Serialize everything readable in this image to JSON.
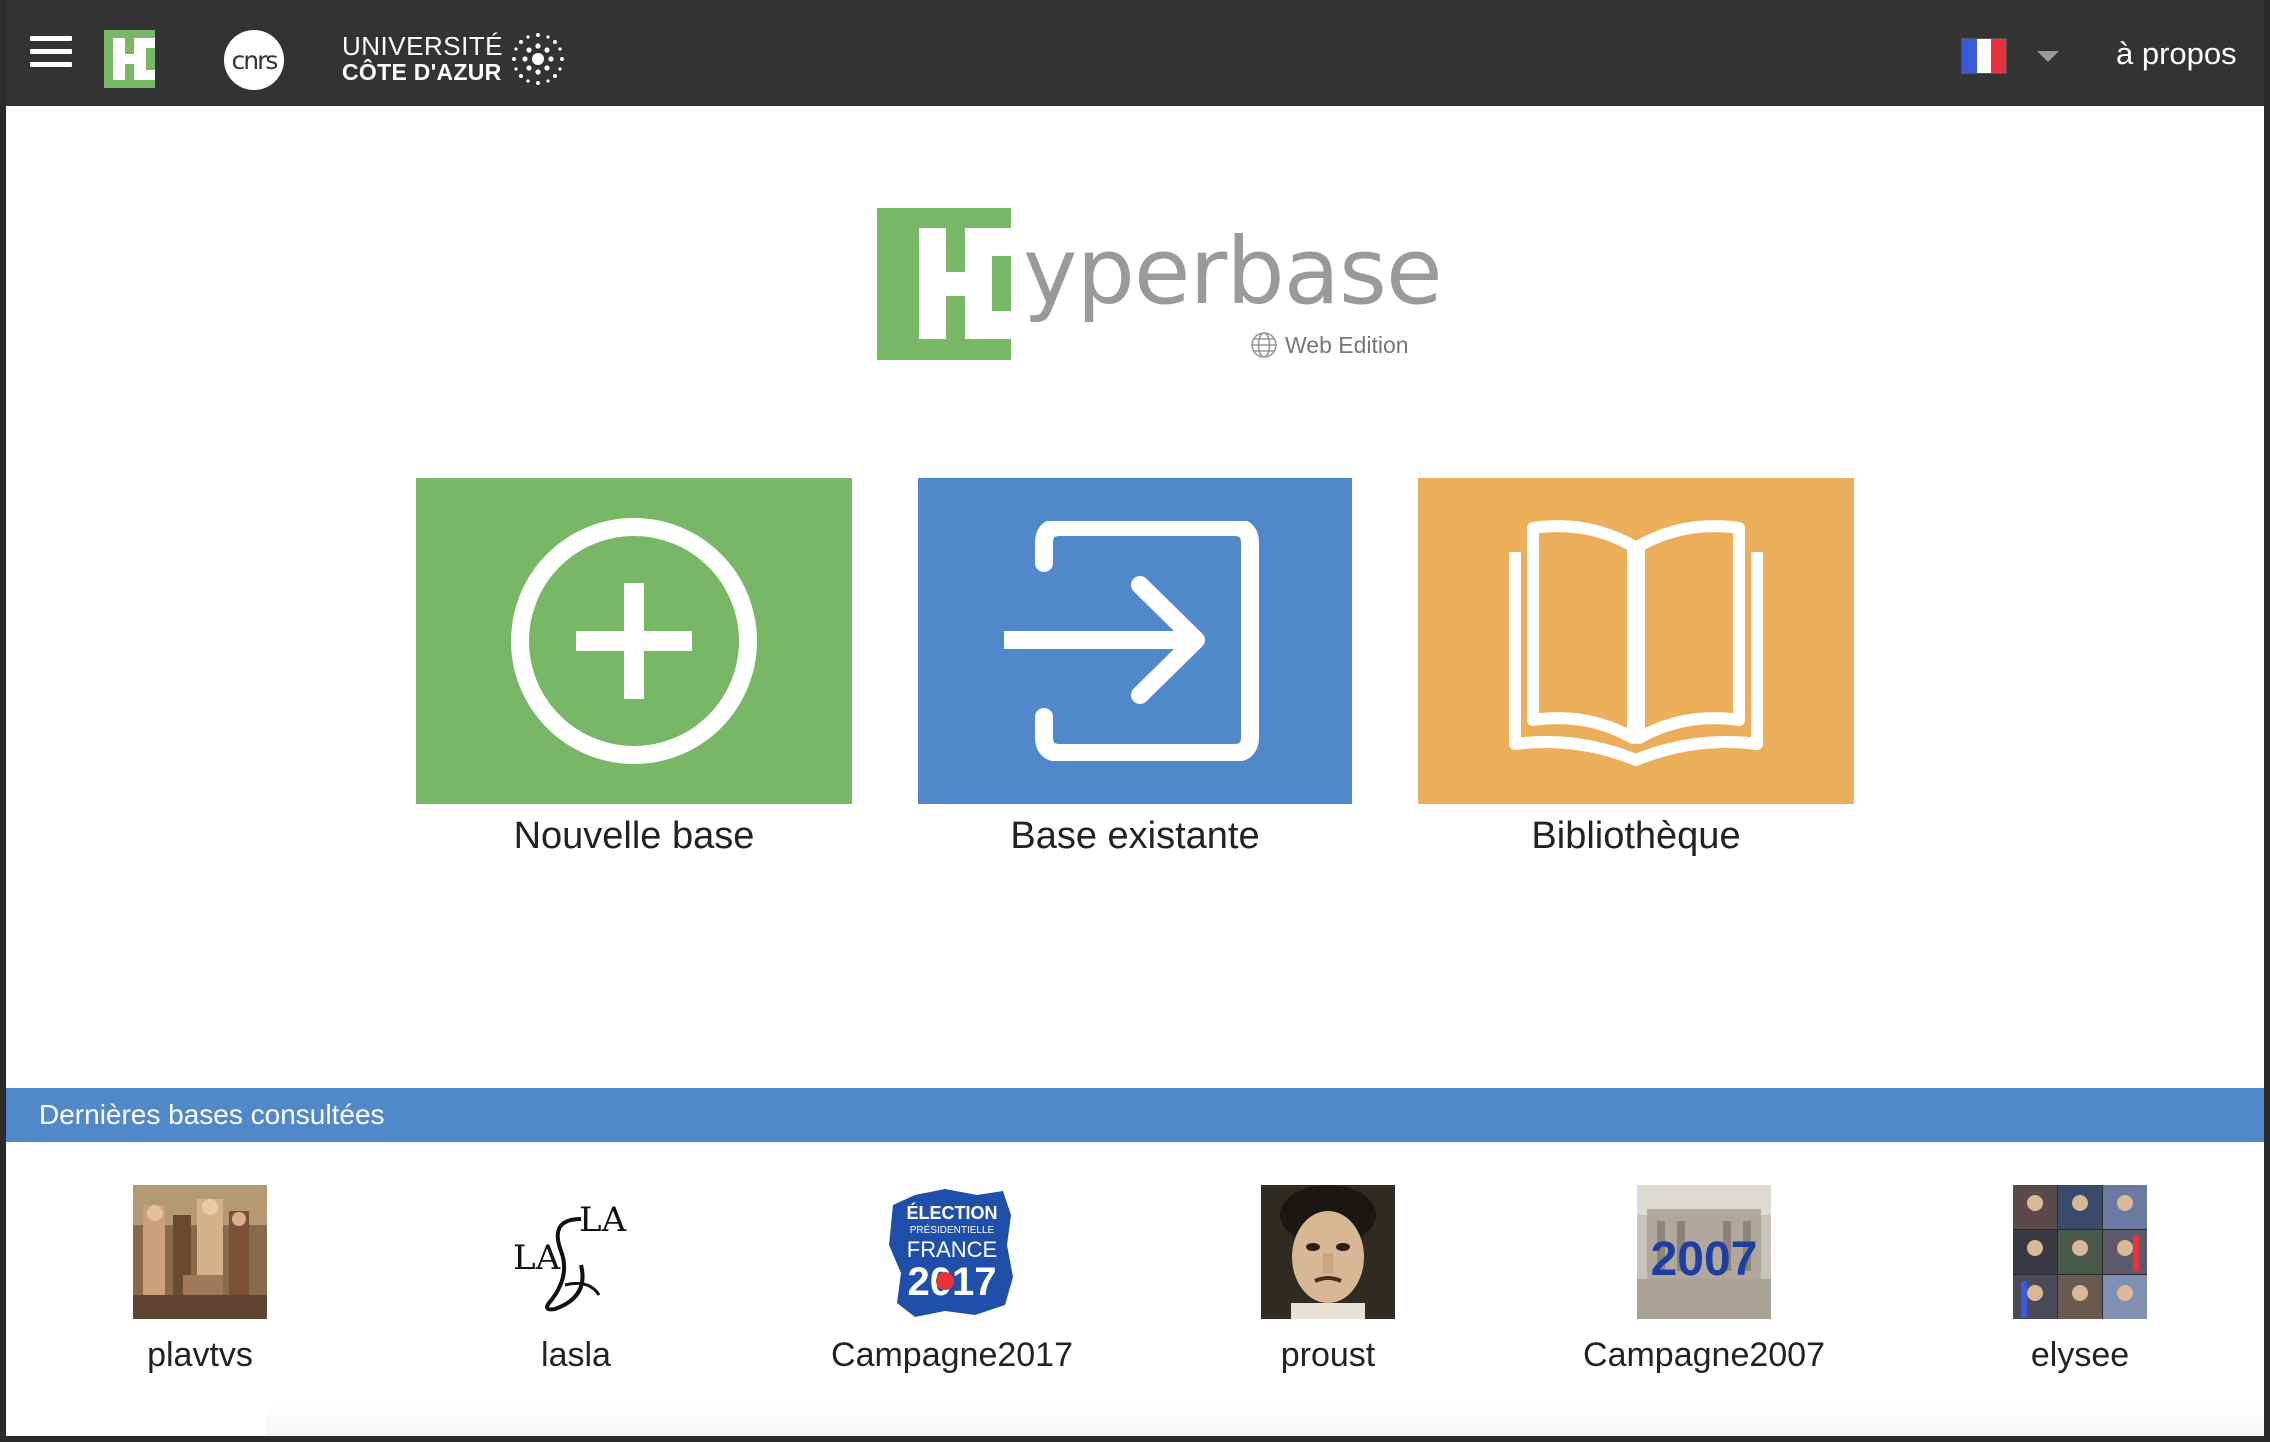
{
  "topbar": {
    "menu_icon": "hamburger-menu-icon",
    "hyperbase_logo": "hyperbase-h-logo",
    "cnrs_logo_text": "cnrs",
    "university_line1": "UNIVERSITÉ",
    "university_line2": "CÔTE D'AZUR",
    "language_flag": "france-flag-icon",
    "about_label": "à propos"
  },
  "hero": {
    "title_rest": "yperbase",
    "subtitle": "Web Edition"
  },
  "tiles": [
    {
      "label": "Nouvelle base",
      "icon": "plus-circle-icon",
      "color": "#77b765"
    },
    {
      "label": "Base existante",
      "icon": "sign-in-arrow-icon",
      "color": "#5088c9"
    },
    {
      "label": "Bibliothèque",
      "icon": "open-book-icon",
      "color": "#ebaf5b"
    }
  ],
  "recent": {
    "title": "Dernières bases consultées",
    "items": [
      {
        "label": "plavtvs"
      },
      {
        "label": "lasla"
      },
      {
        "label": "Campagne2017"
      },
      {
        "label": "proust"
      },
      {
        "label": "Campagne2007"
      },
      {
        "label": "elysee"
      }
    ]
  },
  "thumb_text": {
    "lasla_top": "LA",
    "lasla_left": "LA",
    "c2017_l1": "ÉLECTION",
    "c2017_l2": "PRÉSIDENTIELLE",
    "c2017_l3": "FRANCE",
    "c2017_l4": "2017",
    "c2007_year": "2007"
  }
}
